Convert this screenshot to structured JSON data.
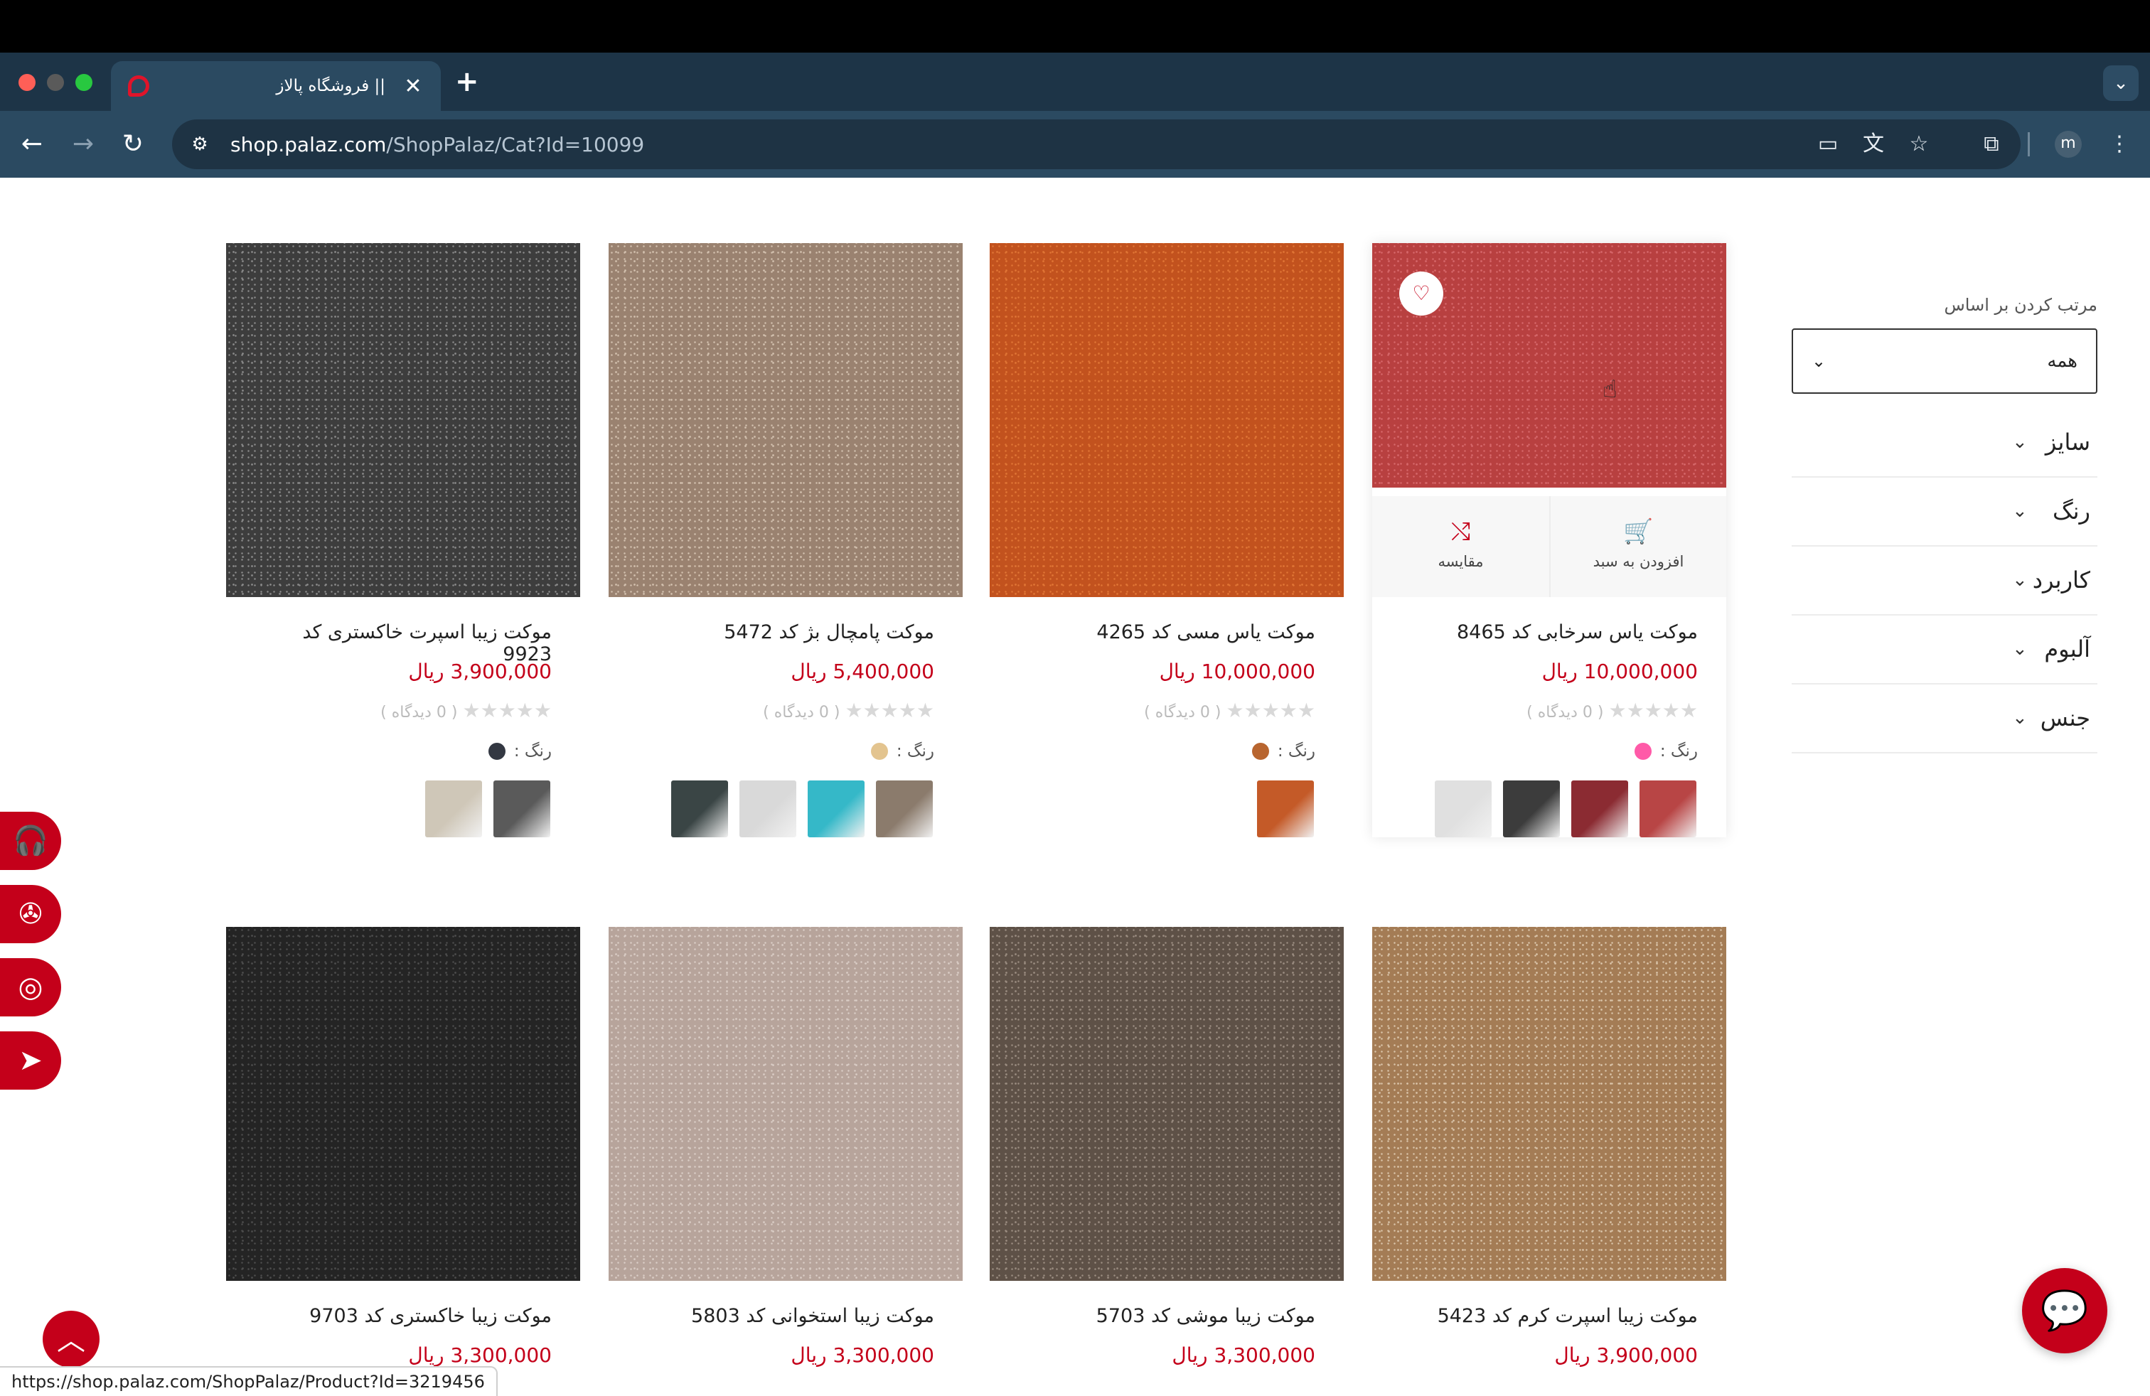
{
  "browser": {
    "tab_title": "|| فروشگاه پالاز",
    "tab_close": "✕",
    "new_tab": "+",
    "tab_menu": "⌄",
    "url_host": "shop.palaz.com",
    "url_path": "/ShopPalaz/Cat?Id=10099",
    "profile_initial": "m",
    "status_url": "https://shop.palaz.com/ShopPalaz/Product?Id=3219456",
    "icons": {
      "back": "←",
      "forward": "→",
      "reload": "↻",
      "site_info": "⚙",
      "install": "▭",
      "translate": "文",
      "bookmark": "☆",
      "extensions": "⧉",
      "menu": "⋮"
    }
  },
  "sidebar": {
    "sort_label": "مرتب کردن بر اساس",
    "sort_value": "همه",
    "chevron": "⌄",
    "filters": [
      "سایز",
      "رنگ",
      "کاربرد",
      "آلبوم",
      "جنس"
    ]
  },
  "product_ui": {
    "color_label": "رنگ :",
    "add_to_cart": "افزودن به سبد",
    "compare": "مقایسه",
    "stars": "★★★★★",
    "wish_icon": "♡",
    "cart_icon": "🛒",
    "compare_icon": "⤭"
  },
  "products": [
    {
      "name": "موکت یاس سرخابی کد 8465",
      "price": "10,000,000 ریال",
      "reviews": "( 0 دیدگاه )",
      "color": "#ff5aa8",
      "texture": [
        "#b84040",
        "#d6676a"
      ],
      "thumbs": [
        "#b84545",
        "#8b2b32",
        "#3c3c3c",
        "#e0e0e0"
      ]
    },
    {
      "name": "موکت یاس مسی کد 4265",
      "price": "10,000,000 ریال",
      "reviews": "( 0 دیدگاه )",
      "color": "#b8652f",
      "texture": [
        "#c2521e",
        "#e07535"
      ],
      "thumbs": [
        "#c45a28"
      ]
    },
    {
      "name": "موکت پامچال بژ کد 5472",
      "price": "5,400,000 ریال",
      "reviews": "( 0 دیدگاه )",
      "color": "#e3c48f",
      "texture": [
        "#9a8270",
        "#d2c0ae"
      ],
      "thumbs": [
        "#8b7b6c",
        "#35b8c8",
        "#d9d9d9",
        "#3a4545"
      ]
    },
    {
      "name": "موکت زیبا اسپرت خاکستری کد 9923",
      "price": "3,900,000 ریال",
      "reviews": "( 0 دیدگاه )",
      "color": "#333842",
      "texture": [
        "#3d3d3d",
        "#8a8a8a"
      ],
      "thumbs": [
        "#5a5a5a",
        "#cfc7b8"
      ]
    },
    {
      "name": "موکت زیبا اسپرت کرم کد 5423",
      "price": "3,900,000 ریال",
      "reviews": "",
      "color": "",
      "texture": [
        "#a47c55",
        "#d9c3a8"
      ],
      "thumbs": []
    },
    {
      "name": "موکت زیبا موشی کد 5703",
      "price": "3,300,000 ریال",
      "reviews": "",
      "color": "",
      "texture": [
        "#5e5147",
        "#9a8c80"
      ],
      "thumbs": []
    },
    {
      "name": "موکت زیبا استخوانی کد 5803",
      "price": "3,300,000 ریال",
      "reviews": "",
      "color": "",
      "texture": [
        "#b7a49b",
        "#d9ccc5"
      ],
      "thumbs": []
    },
    {
      "name": "موکت زیبا خاکستری کد 9703",
      "price": "3,300,000 ریال",
      "reviews": "",
      "color": "",
      "texture": [
        "#242424",
        "#4d4d4d"
      ],
      "thumbs": []
    }
  ],
  "floating": {
    "social_icons": [
      "🎧",
      "✇",
      "◎",
      "➤"
    ],
    "totop_icon": "︿",
    "chat_icon": "💬",
    "cursor": "☝"
  }
}
